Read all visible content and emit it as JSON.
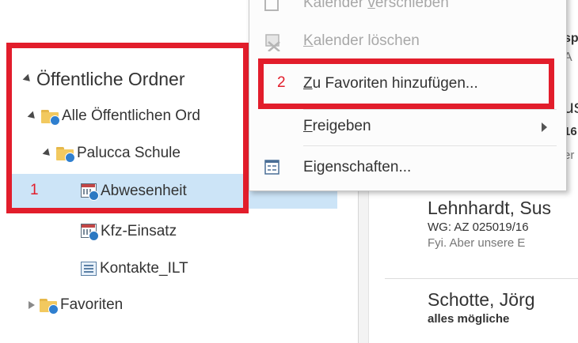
{
  "folder_tree": {
    "root": "Öffentliche Ordner",
    "all_public": "Alle Öffentlichen Ord",
    "school": "Palucca Schule",
    "items": [
      {
        "label": "Abwesenheit",
        "icon": "calendar-icon"
      },
      {
        "label": "Kfz-Einsatz",
        "icon": "calendar-icon"
      },
      {
        "label": "Kontakte_ILT",
        "icon": "contacts-icon"
      }
    ],
    "favorites": "Favoriten"
  },
  "annotations": {
    "step1": "1",
    "step2": "2",
    "color": "#e21d2b"
  },
  "context_menu": {
    "items": [
      {
        "label": "Kalender verschieben",
        "accel": "v",
        "pre": "Kalender ",
        "post": "erschieben",
        "disabled": true
      },
      {
        "label": "Kalender löschen",
        "accel": "K",
        "pre": "",
        "post": "alender löschen",
        "disabled": true
      },
      {
        "label": "Zu Favoriten hinzufügen...",
        "accel": "Z",
        "pre": "",
        "post": "u Favoriten hinzufügen...",
        "disabled": false
      },
      {
        "label": "Freigeben",
        "accel": "F",
        "pre": "",
        "post": "reigeben",
        "disabled": false,
        "submenu": true
      },
      {
        "label": "Eigenschaften...",
        "accel": "g",
        "pre": "Ei",
        "post": "enschaften...",
        "disabled": false
      }
    ]
  },
  "mail_list": {
    "partial_lines": [
      "sp",
      "A",
      "us",
      "16",
      "er"
    ],
    "items": [
      {
        "sender": "Lehnhardt, Sus",
        "subject": "WG: AZ 025019/16",
        "preview": "Fyi.  Aber unsere E"
      },
      {
        "sender": "Schotte, Jörg",
        "subject": "alles mögliche",
        "preview": ""
      }
    ]
  },
  "colors": {
    "selection": "#cce4f7",
    "accent_blue": "#1e73be"
  }
}
